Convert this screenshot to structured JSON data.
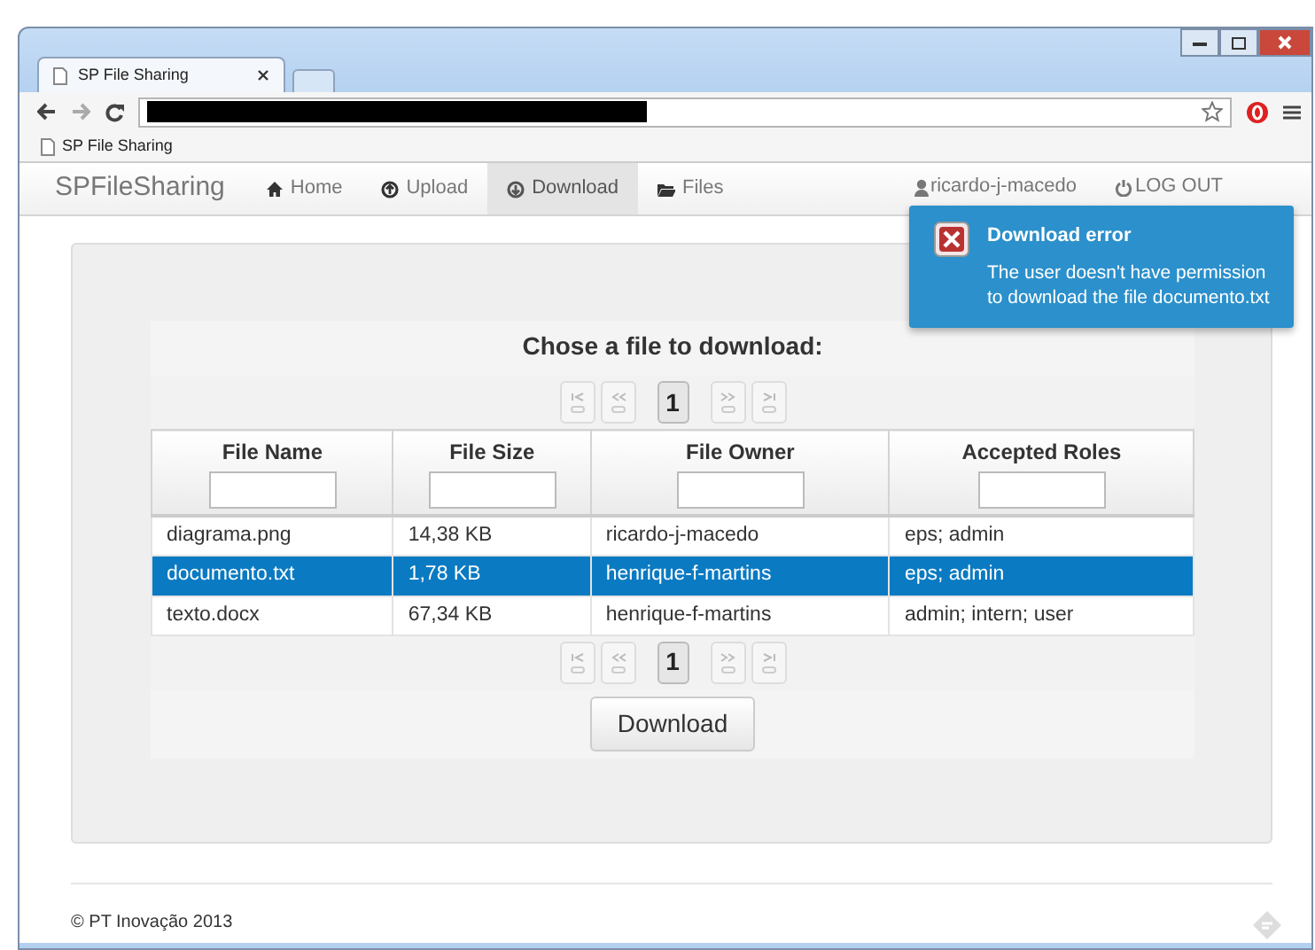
{
  "browser": {
    "tab_title": "SP File Sharing",
    "bookmark": "SP File Sharing"
  },
  "navbar": {
    "brand": "SPFileSharing",
    "items": [
      {
        "label": "Home",
        "selected": false
      },
      {
        "label": "Upload",
        "selected": false
      },
      {
        "label": "Download",
        "selected": true
      },
      {
        "label": "Files",
        "selected": false
      }
    ],
    "user": "ricardo-j-macedo",
    "logout": "LOG OUT"
  },
  "toast": {
    "title": "Download error",
    "message": "The user doesn't have permission to download the file documento.txt"
  },
  "panel": {
    "title": "Chose a file to download:",
    "pager_top": {
      "pages": [
        {
          "label": "1",
          "selected": true
        }
      ]
    },
    "columns": [
      {
        "label": "File Name"
      },
      {
        "label": "File Size"
      },
      {
        "label": "File Owner"
      },
      {
        "label": "Accepted Roles"
      }
    ],
    "rows": [
      {
        "cells": [
          "diagrama.png",
          "14,38 KB",
          "ricardo-j-macedo",
          "eps; admin"
        ],
        "selected": false
      },
      {
        "cells": [
          "documento.txt",
          "1,78 KB",
          "henrique-f-martins",
          "eps; admin"
        ],
        "selected": true
      },
      {
        "cells": [
          "texto.docx",
          "67,34 KB",
          "henrique-f-martins",
          "admin; intern; user"
        ],
        "selected": false
      }
    ],
    "pager_bottom": {
      "pages": [
        {
          "label": "1",
          "selected": true
        }
      ]
    },
    "button": "Download"
  },
  "footer": {
    "copyright": "© PT Inovação 2013"
  }
}
